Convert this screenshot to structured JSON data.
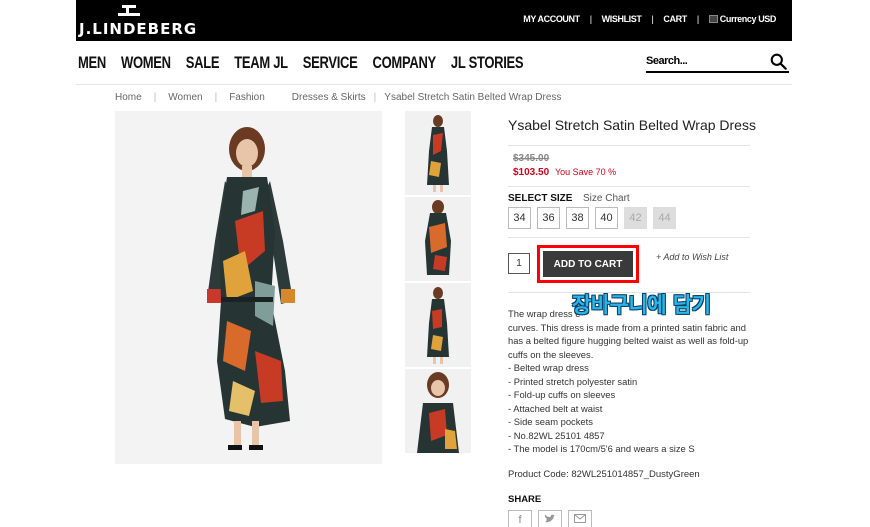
{
  "brand": {
    "name": "J.LINDEBERG"
  },
  "utility": {
    "my_account": "MY ACCOUNT",
    "wishlist": "WISHLIST",
    "cart": "CART",
    "currency": "Currency USD",
    "separator": "|"
  },
  "nav": {
    "items": [
      "MEN",
      "WOMEN",
      "SALE",
      "TEAM JL",
      "SERVICE",
      "COMPANY",
      "JL STORIES"
    ]
  },
  "search": {
    "placeholder": "Search..."
  },
  "breadcrumb": {
    "items": [
      "Home",
      "Women",
      "Fashion",
      "Dresses & Skirts",
      "Ysabel Stretch Satin Belted Wrap Dress"
    ],
    "separator": "|"
  },
  "product": {
    "title": "Ysabel Stretch Satin Belted Wrap Dress",
    "old_price": "$345.00",
    "new_price": "$103.50",
    "save_text": "You Save 70 %",
    "select_size_label": "SELECT SIZE",
    "size_chart_label": "Size Chart",
    "sizes": [
      {
        "label": "34",
        "available": true
      },
      {
        "label": "36",
        "available": true
      },
      {
        "label": "38",
        "available": true
      },
      {
        "label": "40",
        "available": true
      },
      {
        "label": "42",
        "available": false
      },
      {
        "label": "44",
        "available": false
      }
    ],
    "quantity": "1",
    "add_to_cart": "ADD TO CART",
    "add_to_wishlist": "+ Add to Wish List",
    "description": [
      "The wrap dress                                          e",
      "curves. This dress is made from a printed satin fabric and",
      "has a belted figure hugging belted waist as well as fold-up",
      "cuffs on the sleeves.",
      "- Belted wrap dress",
      "- Printed stretch polyester satin",
      "- Fold-up cuffs on sleeves",
      "- Attached belt at waist",
      "- Side seam pockets",
      "- No.82WL 25101 4857",
      "- The model is 170cm/5'6 and wears a size S"
    ],
    "product_code": "Product Code: 82WL251014857_DustyGreen",
    "share_label": "SHARE"
  },
  "annotation": {
    "text": "장바구니에 담기",
    "color": "#29b6e8"
  },
  "colors": {
    "topbar": "#000000",
    "sale_price": "#d0021b",
    "highlight": "#ff0000",
    "cart_button": "#3a3a3a"
  },
  "icons": {
    "search": "search-icon",
    "facebook": "facebook-icon",
    "twitter": "twitter-icon",
    "email": "email-icon"
  }
}
